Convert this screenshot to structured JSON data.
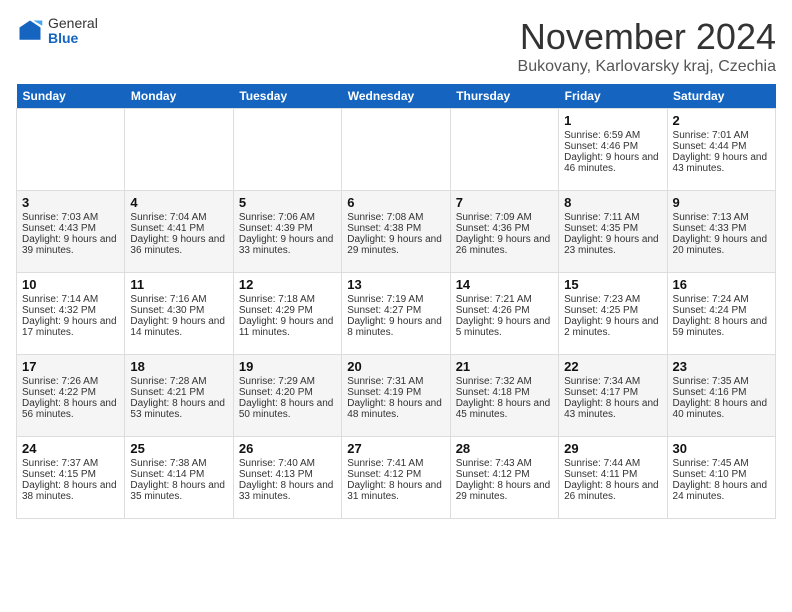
{
  "header": {
    "logo_general": "General",
    "logo_blue": "Blue",
    "title": "November 2024",
    "subtitle": "Bukovany, Karlovarsky kraj, Czechia"
  },
  "days_of_week": [
    "Sunday",
    "Monday",
    "Tuesday",
    "Wednesday",
    "Thursday",
    "Friday",
    "Saturday"
  ],
  "weeks": [
    [
      {
        "day": "",
        "content": ""
      },
      {
        "day": "",
        "content": ""
      },
      {
        "day": "",
        "content": ""
      },
      {
        "day": "",
        "content": ""
      },
      {
        "day": "",
        "content": ""
      },
      {
        "day": "1",
        "content": "Sunrise: 6:59 AM\nSunset: 4:46 PM\nDaylight: 9 hours and 46 minutes."
      },
      {
        "day": "2",
        "content": "Sunrise: 7:01 AM\nSunset: 4:44 PM\nDaylight: 9 hours and 43 minutes."
      }
    ],
    [
      {
        "day": "3",
        "content": "Sunrise: 7:03 AM\nSunset: 4:43 PM\nDaylight: 9 hours and 39 minutes."
      },
      {
        "day": "4",
        "content": "Sunrise: 7:04 AM\nSunset: 4:41 PM\nDaylight: 9 hours and 36 minutes."
      },
      {
        "day": "5",
        "content": "Sunrise: 7:06 AM\nSunset: 4:39 PM\nDaylight: 9 hours and 33 minutes."
      },
      {
        "day": "6",
        "content": "Sunrise: 7:08 AM\nSunset: 4:38 PM\nDaylight: 9 hours and 29 minutes."
      },
      {
        "day": "7",
        "content": "Sunrise: 7:09 AM\nSunset: 4:36 PM\nDaylight: 9 hours and 26 minutes."
      },
      {
        "day": "8",
        "content": "Sunrise: 7:11 AM\nSunset: 4:35 PM\nDaylight: 9 hours and 23 minutes."
      },
      {
        "day": "9",
        "content": "Sunrise: 7:13 AM\nSunset: 4:33 PM\nDaylight: 9 hours and 20 minutes."
      }
    ],
    [
      {
        "day": "10",
        "content": "Sunrise: 7:14 AM\nSunset: 4:32 PM\nDaylight: 9 hours and 17 minutes."
      },
      {
        "day": "11",
        "content": "Sunrise: 7:16 AM\nSunset: 4:30 PM\nDaylight: 9 hours and 14 minutes."
      },
      {
        "day": "12",
        "content": "Sunrise: 7:18 AM\nSunset: 4:29 PM\nDaylight: 9 hours and 11 minutes."
      },
      {
        "day": "13",
        "content": "Sunrise: 7:19 AM\nSunset: 4:27 PM\nDaylight: 9 hours and 8 minutes."
      },
      {
        "day": "14",
        "content": "Sunrise: 7:21 AM\nSunset: 4:26 PM\nDaylight: 9 hours and 5 minutes."
      },
      {
        "day": "15",
        "content": "Sunrise: 7:23 AM\nSunset: 4:25 PM\nDaylight: 9 hours and 2 minutes."
      },
      {
        "day": "16",
        "content": "Sunrise: 7:24 AM\nSunset: 4:24 PM\nDaylight: 8 hours and 59 minutes."
      }
    ],
    [
      {
        "day": "17",
        "content": "Sunrise: 7:26 AM\nSunset: 4:22 PM\nDaylight: 8 hours and 56 minutes."
      },
      {
        "day": "18",
        "content": "Sunrise: 7:28 AM\nSunset: 4:21 PM\nDaylight: 8 hours and 53 minutes."
      },
      {
        "day": "19",
        "content": "Sunrise: 7:29 AM\nSunset: 4:20 PM\nDaylight: 8 hours and 50 minutes."
      },
      {
        "day": "20",
        "content": "Sunrise: 7:31 AM\nSunset: 4:19 PM\nDaylight: 8 hours and 48 minutes."
      },
      {
        "day": "21",
        "content": "Sunrise: 7:32 AM\nSunset: 4:18 PM\nDaylight: 8 hours and 45 minutes."
      },
      {
        "day": "22",
        "content": "Sunrise: 7:34 AM\nSunset: 4:17 PM\nDaylight: 8 hours and 43 minutes."
      },
      {
        "day": "23",
        "content": "Sunrise: 7:35 AM\nSunset: 4:16 PM\nDaylight: 8 hours and 40 minutes."
      }
    ],
    [
      {
        "day": "24",
        "content": "Sunrise: 7:37 AM\nSunset: 4:15 PM\nDaylight: 8 hours and 38 minutes."
      },
      {
        "day": "25",
        "content": "Sunrise: 7:38 AM\nSunset: 4:14 PM\nDaylight: 8 hours and 35 minutes."
      },
      {
        "day": "26",
        "content": "Sunrise: 7:40 AM\nSunset: 4:13 PM\nDaylight: 8 hours and 33 minutes."
      },
      {
        "day": "27",
        "content": "Sunrise: 7:41 AM\nSunset: 4:12 PM\nDaylight: 8 hours and 31 minutes."
      },
      {
        "day": "28",
        "content": "Sunrise: 7:43 AM\nSunset: 4:12 PM\nDaylight: 8 hours and 29 minutes."
      },
      {
        "day": "29",
        "content": "Sunrise: 7:44 AM\nSunset: 4:11 PM\nDaylight: 8 hours and 26 minutes."
      },
      {
        "day": "30",
        "content": "Sunrise: 7:45 AM\nSunset: 4:10 PM\nDaylight: 8 hours and 24 minutes."
      }
    ]
  ]
}
